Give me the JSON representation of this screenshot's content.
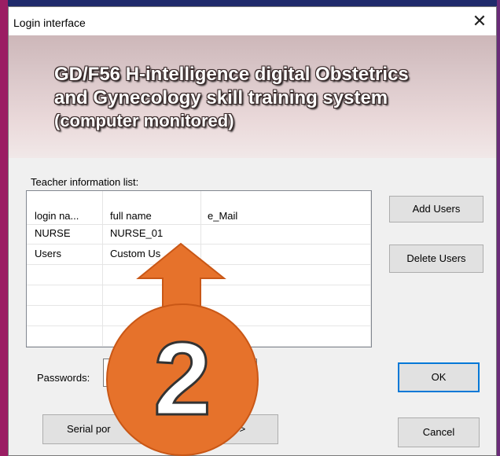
{
  "window": {
    "title": "Login interface"
  },
  "banner": {
    "line1": "GD/F56 H-intelligence digital Obstetrics",
    "line2": "and Gynecology skill training system",
    "line3": "(computer monitored)"
  },
  "teacher_list": {
    "label": "Teacher information list:",
    "columns": [
      "login na...",
      "full name",
      "e_Mail"
    ],
    "rows": [
      [
        "NURSE",
        "NURSE_01",
        ""
      ],
      [
        "Users",
        "Custom Us",
        ""
      ]
    ]
  },
  "buttons": {
    "add_users": "Add Users",
    "delete_users": "Delete Users",
    "ok": "OK",
    "cancel": "Cancel",
    "serial_port": "Serial por",
    "serial_next": ">>"
  },
  "password": {
    "label": "Passwords:",
    "value": ""
  },
  "overlay": {
    "step_number": "2",
    "color": "#e6722b"
  }
}
